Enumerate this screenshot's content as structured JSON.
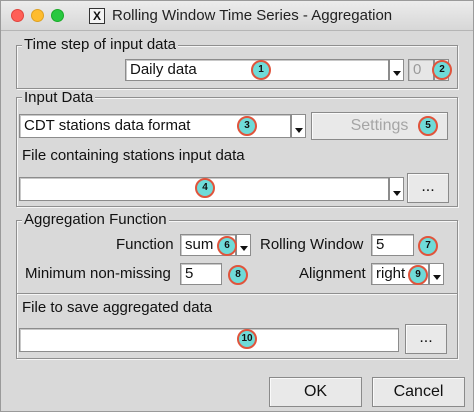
{
  "window": {
    "title": "Rolling Window Time Series - Aggregation"
  },
  "time_step": {
    "legend": "Time step of input data",
    "selected": "Daily data",
    "spin_value": "0"
  },
  "input_data": {
    "legend": "Input Data",
    "format_selected": "CDT stations data format",
    "settings_label": "Settings",
    "file_label": "File containing stations input data",
    "file_value": "",
    "browse_label": "..."
  },
  "aggregation": {
    "legend": "Aggregation Function",
    "function_label": "Function",
    "function_value": "sum",
    "rolling_window_label": "Rolling Window",
    "rolling_window_value": "5",
    "min_nonmissing_label": "Minimum non-missing",
    "min_nonmissing_value": "5",
    "alignment_label": "Alignment",
    "alignment_value": "right"
  },
  "output": {
    "legend": "File to save aggregated data",
    "file_value": "",
    "browse_label": "..."
  },
  "footer": {
    "ok_label": "OK",
    "cancel_label": "Cancel"
  },
  "badges": [
    "1",
    "2",
    "3",
    "4",
    "5",
    "6",
    "7",
    "8",
    "9",
    "10"
  ],
  "colors": {
    "badge_fill": "#6fdbd8",
    "badge_border": "#e0543c"
  }
}
